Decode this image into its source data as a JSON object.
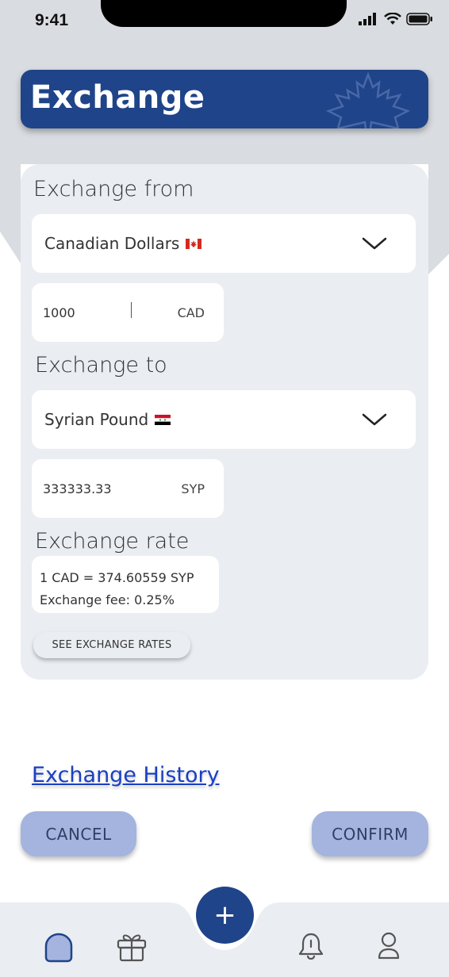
{
  "status": {
    "time": "9:41"
  },
  "header": {
    "title": "Exchange"
  },
  "from": {
    "label": "Exchange from",
    "currency": "Canadian Dollars",
    "amount": "1000",
    "unit": "CAD"
  },
  "to": {
    "label": "Exchange to",
    "currency": "Syrian Pound",
    "amount": "333333.33",
    "unit": "SYP"
  },
  "rate": {
    "label": "Exchange rate",
    "line1": "1 CAD = 374.60559 SYP",
    "line2": "Exchange fee: 0.25%",
    "see_rates": "SEE EXCHANGE RATES"
  },
  "history_link": "Exchange History",
  "actions": {
    "cancel": "CANCEL",
    "confirm": "CONFIRM"
  },
  "fab": "+",
  "nav": [
    "home-icon",
    "gift-icon",
    "bell-icon",
    "user-icon"
  ],
  "colors": {
    "brand": "#1f4489",
    "card": "#eaedf2",
    "button": "#a4b4df",
    "link": "#1a3fc4"
  }
}
